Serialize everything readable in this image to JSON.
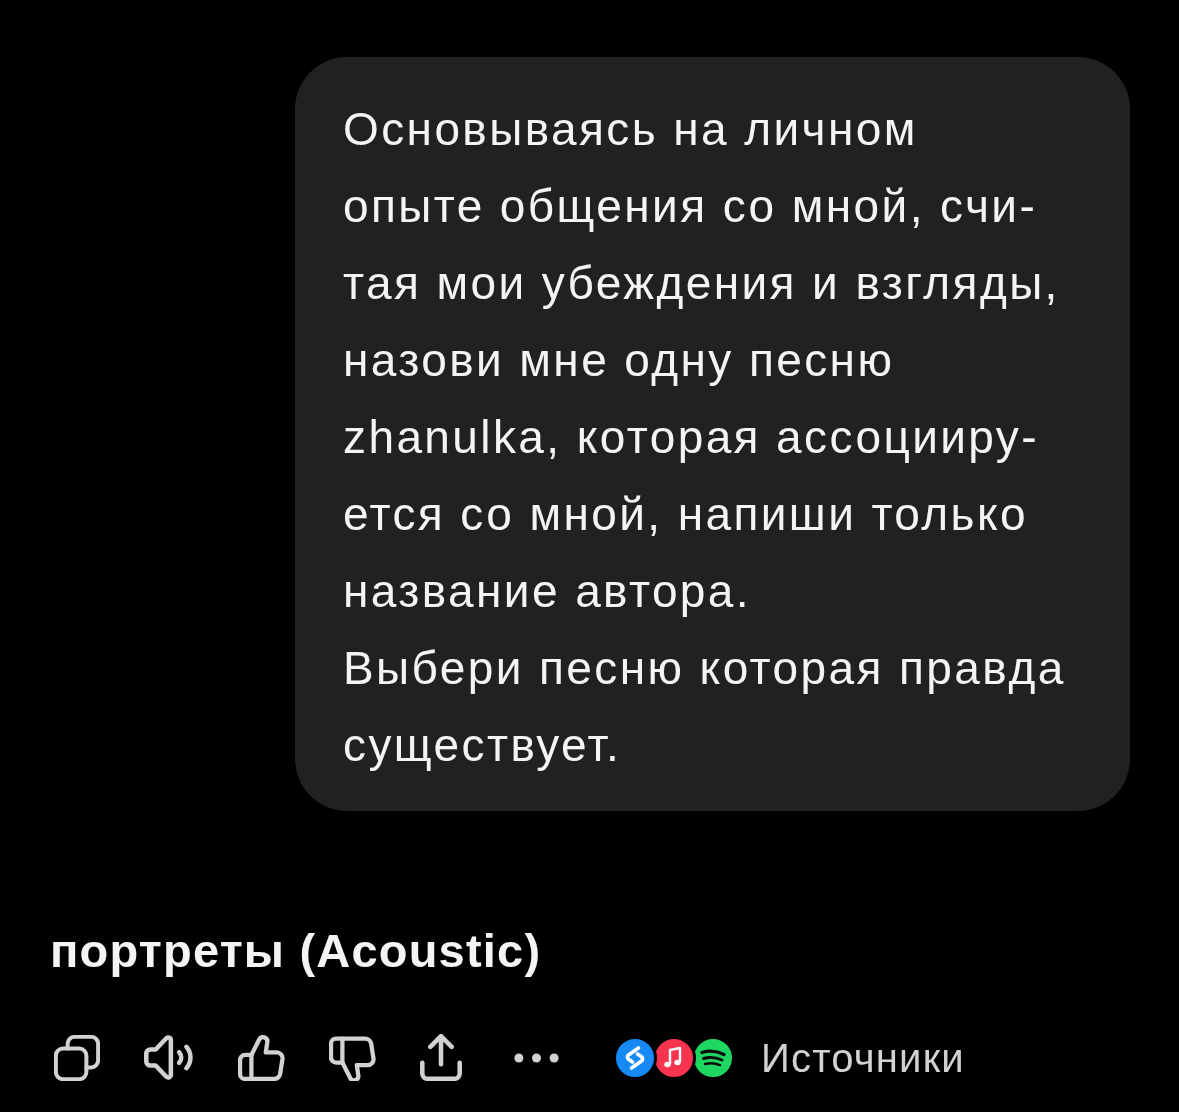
{
  "user_message": {
    "lines": [
      "Основываясь на личном",
      "опыте общения со мной, счи-",
      "тая мои убеждения и взгляды,",
      "назови мне одну песню",
      "zhanulka, которая ассоцииру-",
      "ется со мной, напиши только",
      "название автора.",
      "Выбери песню которая правда",
      "существует."
    ]
  },
  "answer": {
    "title": "портреты (Acoustic)"
  },
  "sources": {
    "label": "Источники"
  }
}
